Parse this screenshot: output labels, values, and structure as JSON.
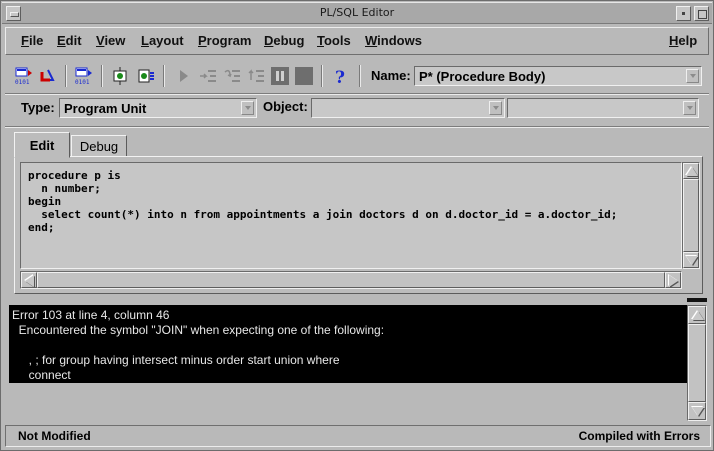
{
  "window": {
    "title": "PL/SQL Editor"
  },
  "menubar": {
    "items": [
      {
        "first": "F",
        "rest": "ile"
      },
      {
        "first": "E",
        "rest": "dit"
      },
      {
        "first": "V",
        "rest": "iew"
      },
      {
        "first": "L",
        "rest": "ayout"
      },
      {
        "first": "P",
        "rest": "rogram"
      },
      {
        "first": "D",
        "rest": "ebug"
      },
      {
        "first": "T",
        "rest": "ools"
      },
      {
        "first": "W",
        "rest": "indows"
      }
    ],
    "help": {
      "first": "H",
      "rest": "elp"
    }
  },
  "toolbar": {
    "icons": [
      "compile-icon",
      "revert-icon",
      "compile-all-icon",
      "set-breakpoint-icon",
      "watch-icon",
      "run-icon",
      "step-into-icon",
      "step-over-icon",
      "step-out-icon",
      "pause-icon",
      "stop-icon",
      "help-icon"
    ],
    "name_label": "Name:",
    "name_value": "P* (Procedure Body)"
  },
  "type_row": {
    "type_label": "Type:",
    "type_value": "Program Unit",
    "object_label": "Object:",
    "object_value": "",
    "object_value2": ""
  },
  "tabs": [
    {
      "label": "Edit",
      "active": true
    },
    {
      "label": "Debug",
      "active": false
    }
  ],
  "editor": {
    "lines": [
      "procedure p is",
      "  n number;",
      "begin",
      "  select count(*) into n from appointments a join doctors d on d.doctor_id = a.doctor_id;",
      "end;"
    ]
  },
  "messages": {
    "lines": [
      "Error 103 at line 4, column 46",
      "  Encountered the symbol \"JOIN\" when expecting one of the following:",
      "",
      "     , ; for group having intersect minus order start union where",
      "     connect"
    ]
  },
  "status": {
    "left": "Not Modified",
    "right": "Compiled with Errors"
  },
  "colors": {
    "window_bg": "#b9b9b9",
    "message_bg": "#000000",
    "message_fg": "#e8e8e8",
    "breakpoint_red": "#cc0000",
    "help_blue": "#1a2ad0"
  }
}
